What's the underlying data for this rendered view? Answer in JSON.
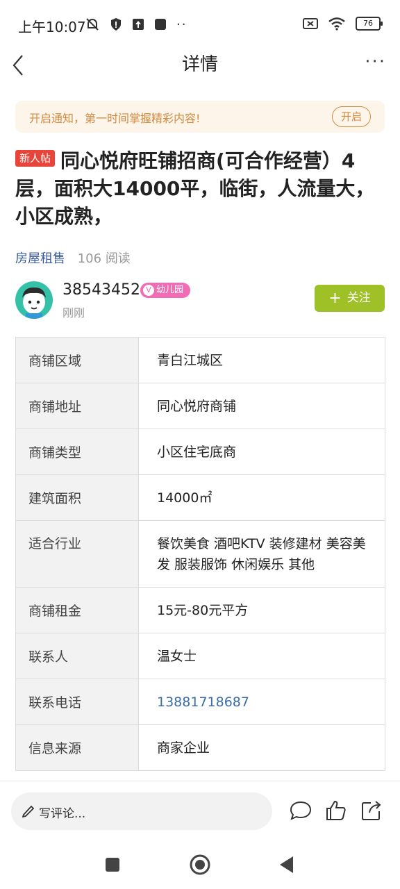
{
  "status_bar": {
    "time": "上午10:07",
    "battery": "76"
  },
  "nav": {
    "title": "详情",
    "more": "···"
  },
  "notify": {
    "text": "开启通知，第一时间掌握精彩内容!",
    "button": "开启"
  },
  "post": {
    "badge": "新人帖",
    "title": "同心悦府旺铺招商(可合作经营）4层，面积大14000平，临街，人流量大，小区成熟，",
    "category": "房屋租售",
    "reads": "106 阅读"
  },
  "author": {
    "name": "38543452",
    "tag": "幼儿园",
    "time": "刚刚",
    "follow": "关注"
  },
  "table": {
    "rows": [
      {
        "key": "商铺区域",
        "value": "青白江城区"
      },
      {
        "key": "商铺地址",
        "value": "同心悦府商铺"
      },
      {
        "key": "商铺类型",
        "value": "小区住宅底商"
      },
      {
        "key": "建筑面积",
        "value": "14000㎡"
      },
      {
        "key": "适合行业",
        "value": "餐饮美食 酒吧KTV 装修建材 美容美发 服装服饰 休闲娱乐 其他"
      },
      {
        "key": "商铺租金",
        "value": "15元-80元平方"
      },
      {
        "key": "联系人",
        "value": "温女士"
      },
      {
        "key": "联系电话",
        "value": "13881718687"
      },
      {
        "key": "信息来源",
        "value": "商家企业"
      }
    ]
  },
  "bottom": {
    "comment_placeholder": "写评论..."
  },
  "colors": {
    "accent_green": "#9ec127",
    "notify_orange": "#d28b40",
    "badge_red": "#e8443a",
    "link_blue": "#3a5ba0"
  }
}
